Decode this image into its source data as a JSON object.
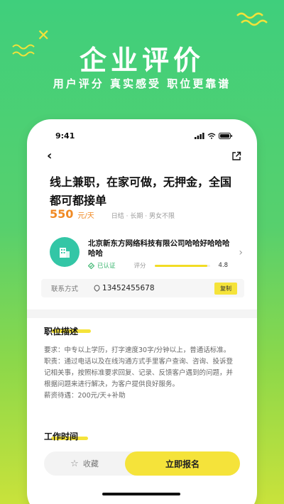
{
  "hero": {
    "title": "企业评价",
    "subtitle": "用户评分 真实感受 职位更靠谱"
  },
  "status_bar": {
    "time": "9:41"
  },
  "nav": {
    "back_icon": "back-arrow-icon",
    "share_icon": "share-icon"
  },
  "job": {
    "title": "线上兼职，在家可做，无押金，全国都可都接单",
    "salary": "550",
    "salary_unit": "元/天",
    "tags": "日结 · 长期 · 男女不限"
  },
  "company": {
    "name": "北京新东方网络科技有限公司哈哈好哈哈哈哈哈",
    "verified": "已认证",
    "rating_label": "评分",
    "rating_value": "4.8",
    "rating_fraction": 0.96
  },
  "contact": {
    "label": "联系方式",
    "phone": "13452455678",
    "copy_label": "复制"
  },
  "description": {
    "title": "职位描述",
    "requirement": "要求：中专以上学历，打字速度30字/分钟以上，普通话标准。",
    "duties": "职责：通过电话以及在线沟通方式手里客户查询、咨询、投诉登记相关事，按照标准要求回复、记录、反馈客户遇到的问题，并根据问题来进行解决，为客户提供良好服务。",
    "salary": "薪资待遇：200元/天+补助"
  },
  "work_time": {
    "title": "工作时间"
  },
  "actions": {
    "favorite_label": "收藏",
    "apply_label": "立即报名"
  },
  "colors": {
    "accent_yellow": "#f5e33a",
    "salary_orange": "#f08a24",
    "verified_green": "#34b36a",
    "logo_teal": "#33c6a6"
  }
}
